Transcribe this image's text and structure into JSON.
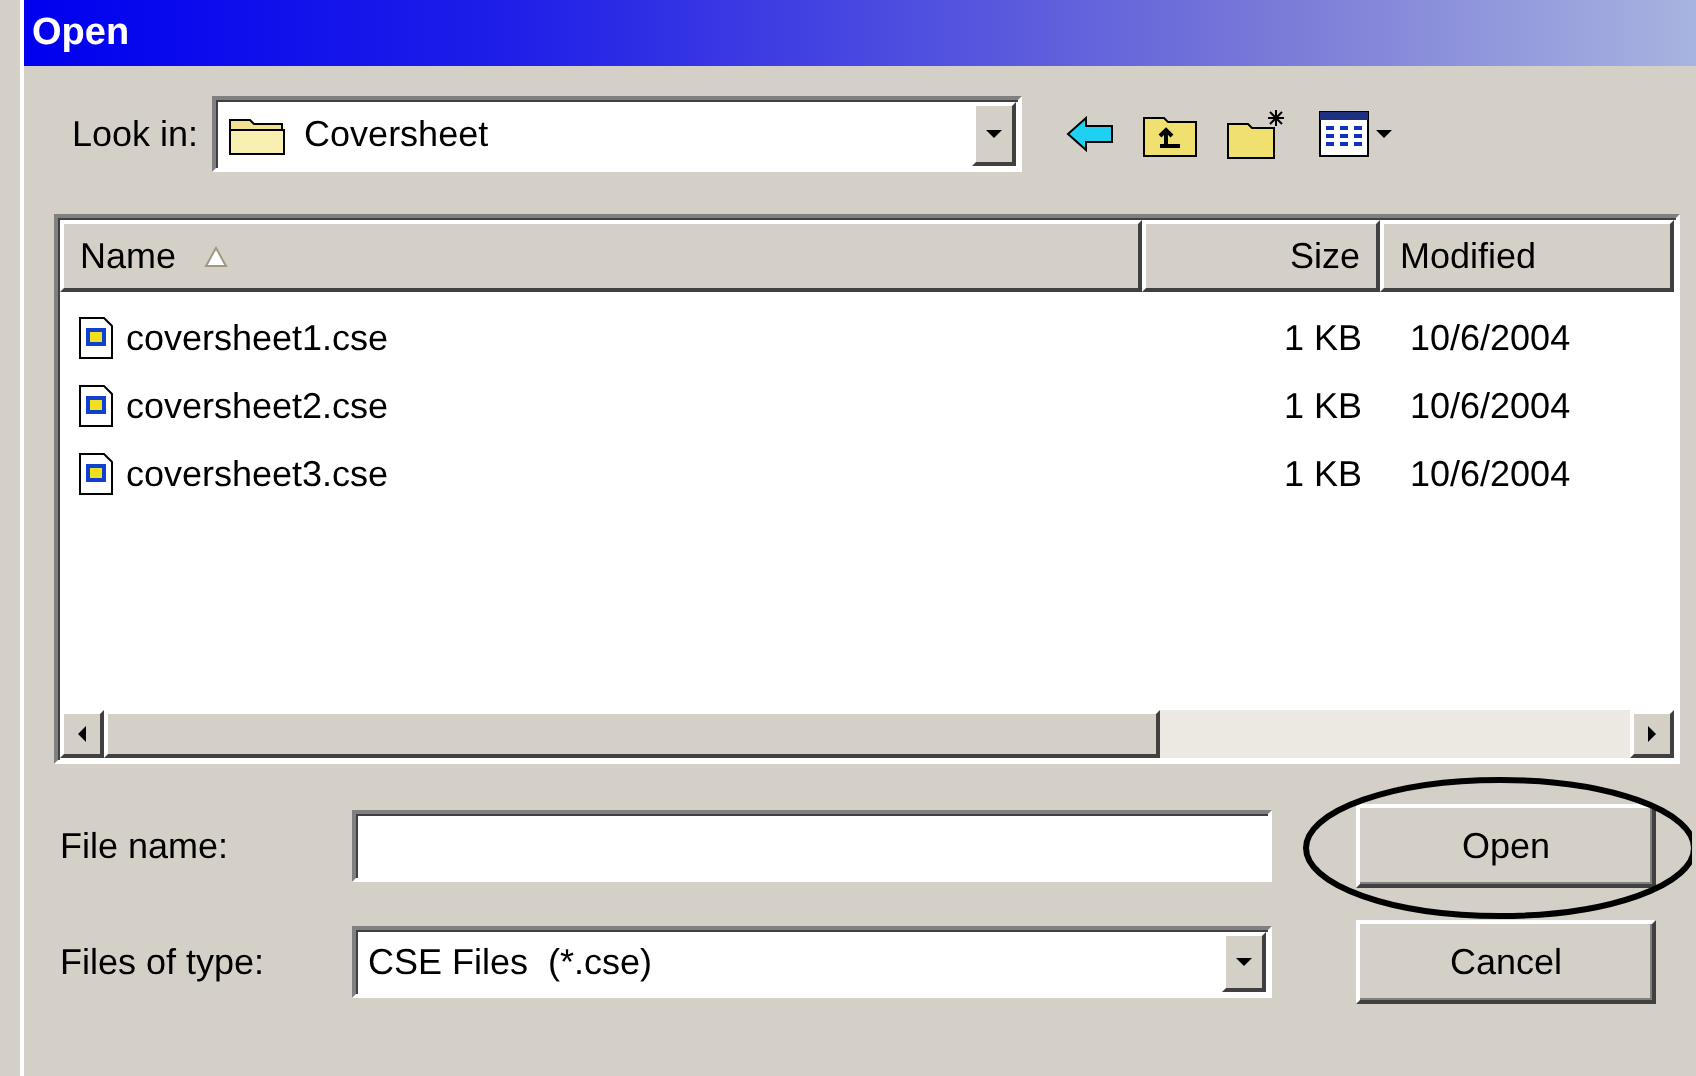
{
  "window": {
    "title": "Open"
  },
  "look_in": {
    "label": "Look in:",
    "value": "Coversheet"
  },
  "file_list": {
    "columns": [
      {
        "label": "Name",
        "sorted": true
      },
      {
        "label": "Size",
        "sorted": false
      },
      {
        "label": "Modified",
        "sorted": false
      }
    ],
    "rows": [
      {
        "name": "coversheet1.cse",
        "size": "1 KB",
        "modified": "10/6/2004"
      },
      {
        "name": "coversheet2.cse",
        "size": "1 KB",
        "modified": "10/6/2004"
      },
      {
        "name": "coversheet3.cse",
        "size": "1 KB",
        "modified": "10/6/2004"
      }
    ]
  },
  "file_name": {
    "label": "File name:"
  },
  "file_type": {
    "label": "Files of type:",
    "value": "CSE Files  (*.cse)"
  },
  "buttons": [
    {
      "label": "Open",
      "circled": true
    },
    {
      "label": "Cancel",
      "circled": false
    }
  ]
}
